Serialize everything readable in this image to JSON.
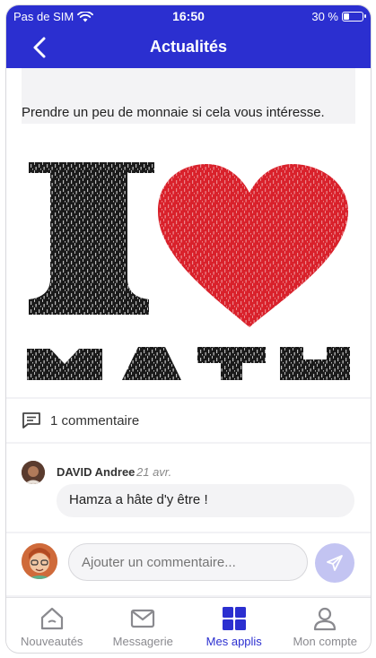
{
  "status_bar": {
    "carrier": "Pas de SIM",
    "time": "16:50",
    "battery": "30 %",
    "battery_level": 0.3
  },
  "header": {
    "title": "Actualités"
  },
  "post": {
    "text": "Prendre un peu de monnaie si cela vous intéresse.",
    "image_text": [
      "I",
      "MATH"
    ],
    "comment_count_label": "1 commentaire"
  },
  "comments": [
    {
      "author": "DAVID Andree",
      "date": "21 avr.",
      "text": "Hamza a hâte d'y être !"
    }
  ],
  "composer": {
    "placeholder": "Ajouter un commentaire..."
  },
  "tabs": [
    {
      "label": "Nouveautés",
      "icon": "home-icon",
      "active": false
    },
    {
      "label": "Messagerie",
      "icon": "mail-icon",
      "active": false
    },
    {
      "label": "Mes applis",
      "icon": "apps-grid-icon",
      "active": true
    },
    {
      "label": "Mon compte",
      "icon": "user-icon",
      "active": false
    }
  ],
  "colors": {
    "primary": "#2b2fd0",
    "send_button": "#c3c4f2",
    "heart": "#d9212b"
  }
}
